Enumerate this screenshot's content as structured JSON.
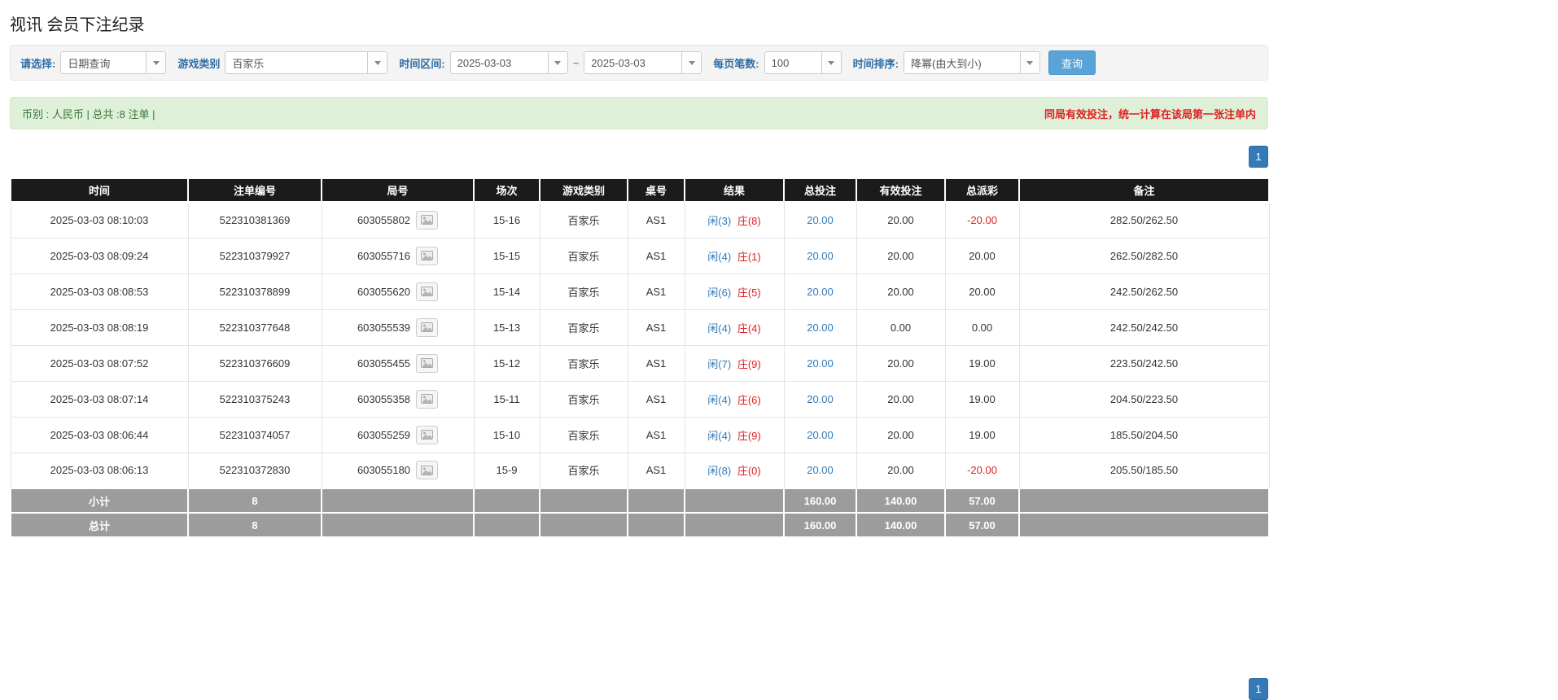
{
  "page": {
    "title": "视讯 会员下注纪录"
  },
  "filters": {
    "select_label": "请选择:",
    "select_value": "日期查询",
    "game_type_label": "游戏类别",
    "game_type_value": "百家乐",
    "date_range_label": "时间区间:",
    "date_from": "2025-03-03",
    "date_separator": "~",
    "date_to": "2025-03-03",
    "page_size_label": "每页笔数:",
    "page_size_value": "100",
    "sort_label": "时间排序:",
    "sort_value": "降幂(由大到小)",
    "search_button": "查询"
  },
  "summary": {
    "left": "币别 : 人民币 | 总共 :8 注单 |",
    "right": "同局有效投注，统一计算在该局第一张注单内"
  },
  "pagination": {
    "page": "1"
  },
  "table": {
    "headers": [
      "时间",
      "注单编号",
      "局号",
      "场次",
      "游戏类别",
      "桌号",
      "结果",
      "总投注",
      "有效投注",
      "总派彩",
      "备注"
    ],
    "rows": [
      {
        "time": "2025-03-03 08:10:03",
        "bet_id": "522310381369",
        "round_id": "603055802",
        "session": "15-16",
        "game": "百家乐",
        "table_no": "AS1",
        "result_player": "闲(3)",
        "result_banker": "庄(8)",
        "total_bet": "20.00",
        "valid_bet": "20.00",
        "payout": "-20.00",
        "remark": "282.50/262.50"
      },
      {
        "time": "2025-03-03 08:09:24",
        "bet_id": "522310379927",
        "round_id": "603055716",
        "session": "15-15",
        "game": "百家乐",
        "table_no": "AS1",
        "result_player": "闲(4)",
        "result_banker": "庄(1)",
        "total_bet": "20.00",
        "valid_bet": "20.00",
        "payout": "20.00",
        "remark": "262.50/282.50"
      },
      {
        "time": "2025-03-03 08:08:53",
        "bet_id": "522310378899",
        "round_id": "603055620",
        "session": "15-14",
        "game": "百家乐",
        "table_no": "AS1",
        "result_player": "闲(6)",
        "result_banker": "庄(5)",
        "total_bet": "20.00",
        "valid_bet": "20.00",
        "payout": "20.00",
        "remark": "242.50/262.50"
      },
      {
        "time": "2025-03-03 08:08:19",
        "bet_id": "522310377648",
        "round_id": "603055539",
        "session": "15-13",
        "game": "百家乐",
        "table_no": "AS1",
        "result_player": "闲(4)",
        "result_banker": "庄(4)",
        "total_bet": "20.00",
        "valid_bet": "0.00",
        "payout": "0.00",
        "remark": "242.50/242.50"
      },
      {
        "time": "2025-03-03 08:07:52",
        "bet_id": "522310376609",
        "round_id": "603055455",
        "session": "15-12",
        "game": "百家乐",
        "table_no": "AS1",
        "result_player": "闲(7)",
        "result_banker": "庄(9)",
        "total_bet": "20.00",
        "valid_bet": "20.00",
        "payout": "19.00",
        "remark": "223.50/242.50"
      },
      {
        "time": "2025-03-03 08:07:14",
        "bet_id": "522310375243",
        "round_id": "603055358",
        "session": "15-11",
        "game": "百家乐",
        "table_no": "AS1",
        "result_player": "闲(4)",
        "result_banker": "庄(6)",
        "total_bet": "20.00",
        "valid_bet": "20.00",
        "payout": "19.00",
        "remark": "204.50/223.50"
      },
      {
        "time": "2025-03-03 08:06:44",
        "bet_id": "522310374057",
        "round_id": "603055259",
        "session": "15-10",
        "game": "百家乐",
        "table_no": "AS1",
        "result_player": "闲(4)",
        "result_banker": "庄(9)",
        "total_bet": "20.00",
        "valid_bet": "20.00",
        "payout": "19.00",
        "remark": "185.50/204.50"
      },
      {
        "time": "2025-03-03 08:06:13",
        "bet_id": "522310372830",
        "round_id": "603055180",
        "session": "15-9",
        "game": "百家乐",
        "table_no": "AS1",
        "result_player": "闲(8)",
        "result_banker": "庄(0)",
        "total_bet": "20.00",
        "valid_bet": "20.00",
        "payout": "-20.00",
        "remark": "205.50/185.50"
      }
    ],
    "subtotal_row": [
      "小计",
      "8",
      "",
      "",
      "",
      "",
      "",
      "160.00",
      "140.00",
      "57.00",
      ""
    ],
    "total_row": [
      "总计",
      "8",
      "",
      "",
      "",
      "",
      "",
      "160.00",
      "140.00",
      "57.00",
      ""
    ]
  }
}
